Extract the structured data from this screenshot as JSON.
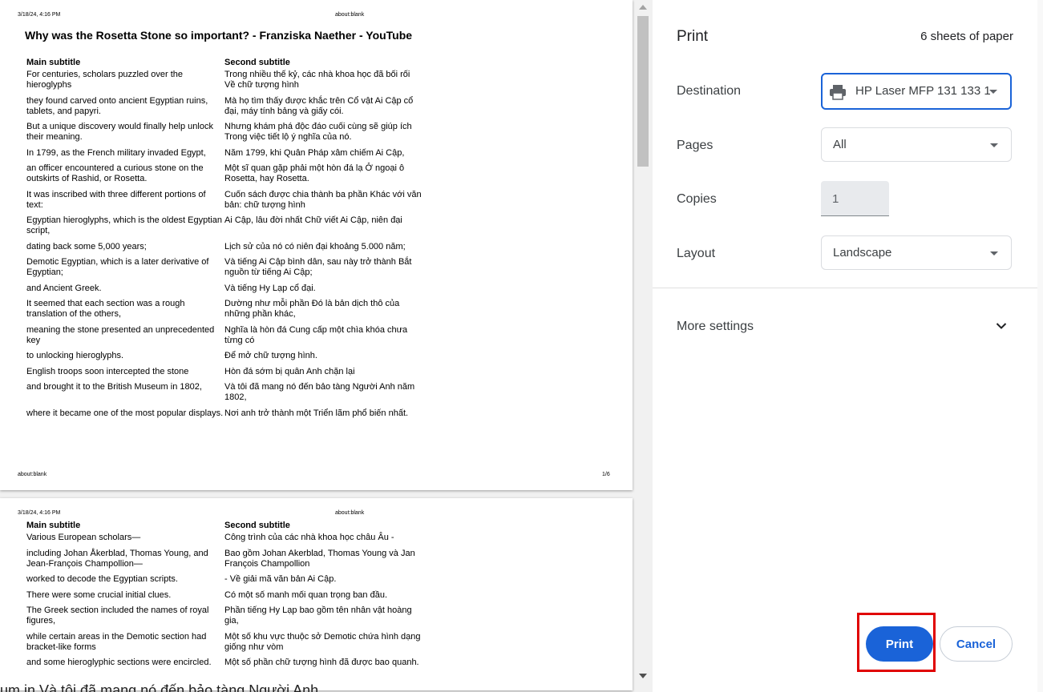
{
  "preview": {
    "page1": {
      "header_left": "3/18/24, 4:16 PM",
      "header_center": "about:blank",
      "title": "Why was the Rosetta Stone so important? - Franziska Naether - YouTube",
      "col1_header": "Main subtitle",
      "col2_header": "Second subtitle",
      "rows": [
        {
          "en": "For centuries, scholars puzzled over the hieroglyphs",
          "vi": "Trong nhiều thế kỷ, các nhà khoa học đã bối rối Về chữ tượng hình"
        },
        {
          "en": "they found carved onto ancient Egyptian ruins, tablets, and papyri.",
          "vi": "Mà họ tìm thấy được khắc trên Cổ vật Ai Cập cổ đại, máy tính bảng và giấy cói."
        },
        {
          "en": "But a unique discovery would finally help unlock their meaning.",
          "vi": "Nhưng khám phá độc đáo cuối cùng sẽ giúp ích Trong việc tiết lộ ý nghĩa của nó."
        },
        {
          "en": "In 1799, as the French military invaded Egypt,",
          "vi": "Năm 1799, khi Quân Pháp xâm chiếm Ai Cập,"
        },
        {
          "en": "an officer encountered a curious stone on the outskirts of Rashid, or Rosetta.",
          "vi": "Một sĩ quan gặp phải một hòn đá lạ Ở ngoại ô Rosetta, hay Rosetta."
        },
        {
          "en": "It was inscribed with three different portions of text:",
          "vi": "Cuốn sách được chia thành ba phần Khác với văn bản: chữ tượng hình"
        },
        {
          "en": "Egyptian hieroglyphs, which is the oldest Egyptian script,",
          "vi": "Ai Cập, lâu đời nhất Chữ viết Ai Cập, niên đại"
        },
        {
          "en": "dating back some 5,000 years;",
          "vi": "Lịch sử của nó có niên đại khoảng 5.000 năm;"
        },
        {
          "en": "Demotic Egyptian, which is a later derivative of Egyptian;",
          "vi": "Và tiếng Ai Cập bình dân, sau này trở thành Bắt nguồn từ tiếng Ai Cập;"
        },
        {
          "en": "and Ancient Greek.",
          "vi": "Và tiếng Hy Lạp cổ đại."
        },
        {
          "en": "It seemed that each section was a rough translation of the others,",
          "vi": "Dường như mỗi phần Đó là bản dịch thô của những phần khác,"
        },
        {
          "en": "meaning the stone presented an unprecedented key",
          "vi": "Nghĩa là hòn đá Cung cấp một chìa khóa chưa từng có"
        },
        {
          "en": "to unlocking hieroglyphs.",
          "vi": "Để mở chữ tượng hình."
        },
        {
          "en": "English troops soon intercepted the stone",
          "vi": "Hòn đá sớm bị quân Anh chặn lại"
        },
        {
          "en": "and brought it to the British Museum in 1802,",
          "vi": "Và tôi đã mang nó đến bảo tàng Người Anh năm 1802,"
        },
        {
          "en": "where it became one of the most popular displays.",
          "vi": "Nơi anh trở thành một Triển lãm phổ biến nhất."
        }
      ],
      "footer_left": "about:blank",
      "footer_right": "1/6"
    },
    "page2": {
      "header_left": "3/18/24, 4:16 PM",
      "header_center": "about:blank",
      "col1_header": "Main subtitle",
      "col2_header": "Second subtitle",
      "rows": [
        {
          "en": "Various European scholars—",
          "vi": "Công trình của các nhà khoa học châu Âu -"
        },
        {
          "en": "including Johan Åkerblad, Thomas Young, and Jean-François Champollion—",
          "vi": "Bao gồm Johan Akerblad, Thomas Young và Jan François Champollion"
        },
        {
          "en": "worked to decode the Egyptian scripts.",
          "vi": "- Về giải mã văn bản Ai Cập."
        },
        {
          "en": "There were some crucial initial clues.",
          "vi": "Có một số manh mối quan trọng ban đầu."
        },
        {
          "en": "The Greek section included the names of royal figures,",
          "vi": "Phần tiếng Hy Lạp bao gồm tên nhân vật hoàng gia,"
        },
        {
          "en": "while certain areas in the Demotic section had bracket-like forms",
          "vi": "Một số khu vực thuộc sở Demotic chứa hình dạng giống như vòm"
        },
        {
          "en": "and some hieroglyphic sections were encircled.",
          "vi": "Một số phần chữ tượng hình đã được bao quanh."
        }
      ]
    },
    "bleed_text": "um in          Và tôi đã mang nó đến bảo tàng Người Anh"
  },
  "panel": {
    "title": "Print",
    "sheets": "6 sheets of paper",
    "destination_label": "Destination",
    "destination_value": "HP Laser MFP 131 133 1",
    "pages_label": "Pages",
    "pages_value": "All",
    "copies_label": "Copies",
    "copies_value": "1",
    "layout_label": "Layout",
    "layout_value": "Landscape",
    "more_settings": "More settings",
    "print_button": "Print",
    "cancel_button": "Cancel"
  },
  "colors": {
    "accent": "#1a63d8",
    "highlight": "#e00000"
  }
}
